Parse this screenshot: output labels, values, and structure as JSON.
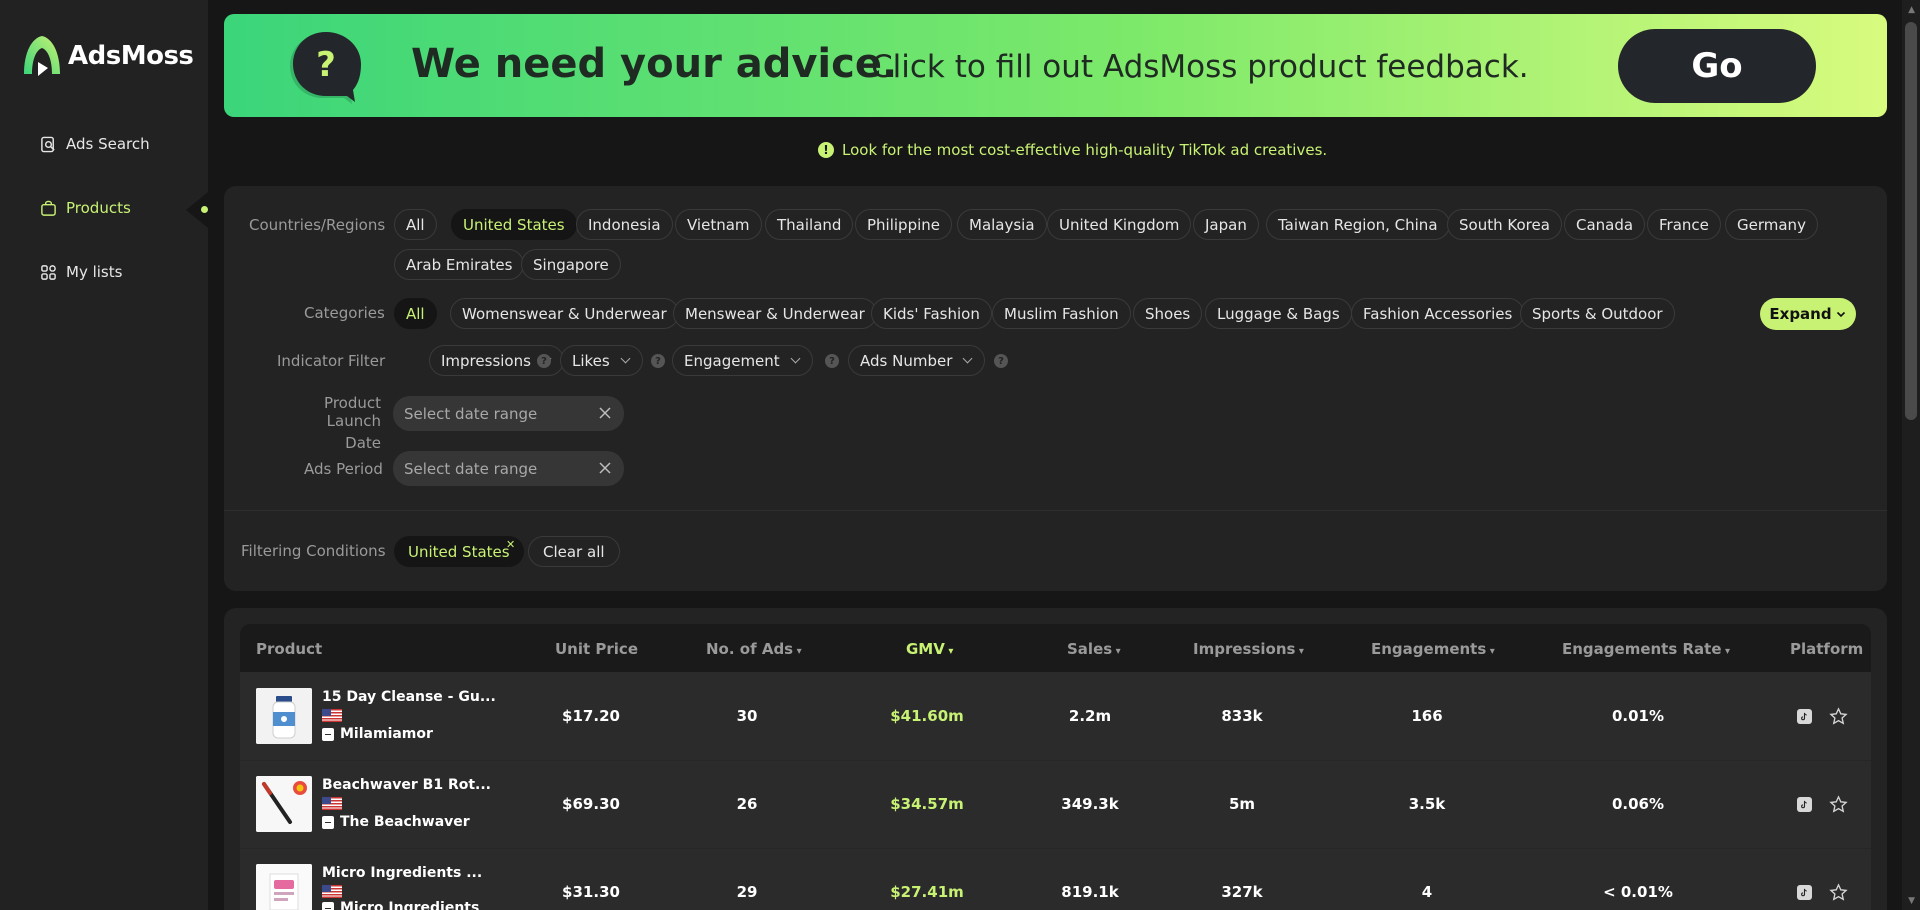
{
  "brand": {
    "name": "AdsMoss",
    "accent": "#c8f274"
  },
  "sidebar": {
    "items": [
      {
        "label": "Ads Search",
        "icon": "search-doc-icon",
        "active": false
      },
      {
        "label": "Products",
        "icon": "bag-icon",
        "active": true
      },
      {
        "label": "My lists",
        "icon": "grid-icon",
        "active": false
      }
    ]
  },
  "banner": {
    "title": "We need your advice.",
    "subtitle": "Click to fill out AdsMoss product feedback.",
    "button": "Go"
  },
  "tip": "Look for the most cost-effective high-quality TikTok ad creatives.",
  "filters": {
    "countries_label": "Countries/Regions",
    "countries": [
      "All",
      "United States",
      "Indonesia",
      "Vietnam",
      "Thailand",
      "Philippine",
      "Malaysia",
      "United Kingdom",
      "Japan",
      "Taiwan Region, China",
      "South Korea",
      "Canada",
      "France",
      "Germany",
      "Arab Emirates",
      "Singapore"
    ],
    "countries_selected": "United States",
    "categories_label": "Categories",
    "categories": [
      "All",
      "Womenswear & Underwear",
      "Menswear & Underwear",
      "Kids' Fashion",
      "Muslim Fashion",
      "Shoes",
      "Luggage & Bags",
      "Fashion Accessories",
      "Sports & Outdoor"
    ],
    "categories_selected": "All",
    "expand": "Expand",
    "indicator_label": "Indicator Filter",
    "indicators": [
      "Impressions",
      "Likes",
      "Engagement",
      "Ads Number"
    ],
    "launch_label_1": "Product Launch",
    "launch_label_2": "Date",
    "launch_placeholder": "Select date range",
    "period_label": "Ads Period",
    "period_placeholder": "Select date range",
    "conditions_label": "Filtering Conditions",
    "condition_chip": "United States",
    "clear_all": "Clear all"
  },
  "table": {
    "headers": {
      "product": "Product",
      "unit_price": "Unit Price",
      "ads": "No. of Ads",
      "gmv": "GMV",
      "sales": "Sales",
      "impressions": "Impressions",
      "engagements": "Engagements",
      "rate": "Engagements Rate",
      "platform": "Platform"
    },
    "rows": [
      {
        "name": "15 Day Cleanse - Gu...",
        "shop": "Milamiamor",
        "unit_price": "$17.20",
        "ads": "30",
        "gmv": "$41.60m",
        "sales": "2.2m",
        "impressions": "833k",
        "engagements": "166",
        "rate": "0.01%",
        "platform": "tiktok-icon"
      },
      {
        "name": "Beachwaver B1 Rot...",
        "shop": "The Beachwaver",
        "unit_price": "$69.30",
        "ads": "26",
        "gmv": "$34.57m",
        "sales": "349.3k",
        "impressions": "5m",
        "engagements": "3.5k",
        "rate": "0.06%",
        "platform": "tiktok-icon"
      },
      {
        "name": "Micro Ingredients ...",
        "shop": "Micro Ingredients",
        "unit_price": "$31.30",
        "ads": "29",
        "gmv": "$27.41m",
        "sales": "819.1k",
        "impressions": "327k",
        "engagements": "4",
        "rate": "< 0.01%",
        "platform": "tiktok-icon"
      }
    ]
  }
}
